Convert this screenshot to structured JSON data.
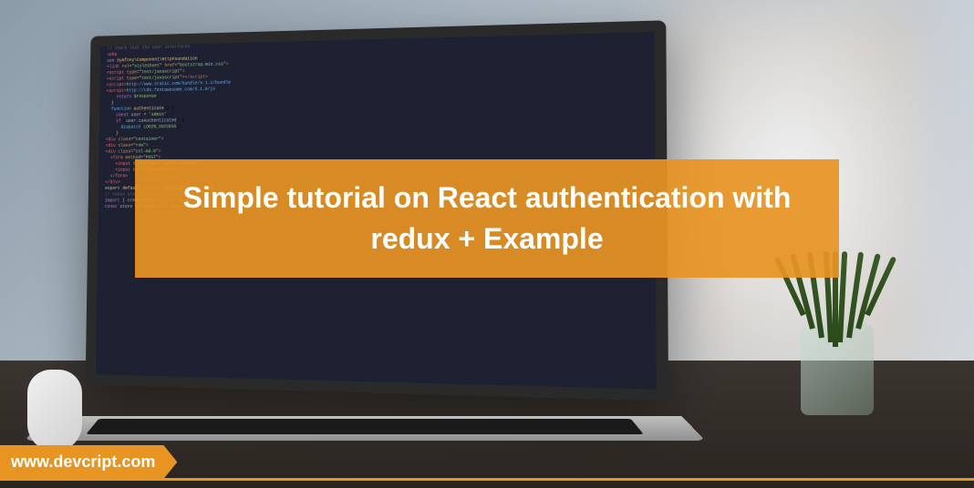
{
  "title": "Simple tutorial on React authentication with redux + Example",
  "website": "www.devcript.com",
  "colors": {
    "accent": "#e89423",
    "text": "#ffffff"
  }
}
